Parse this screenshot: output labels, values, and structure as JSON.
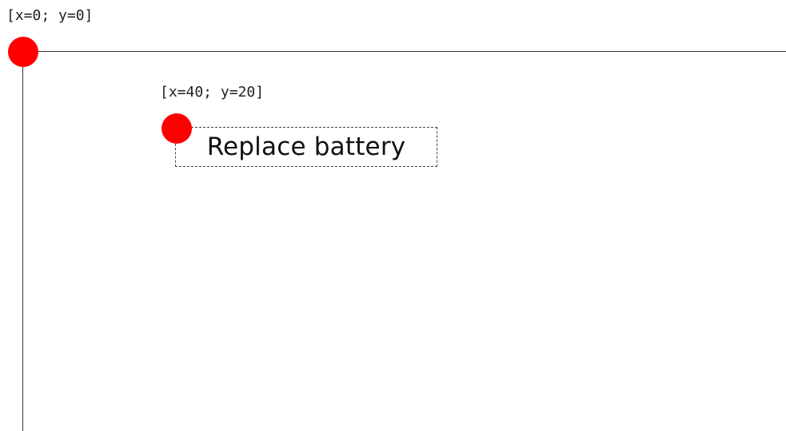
{
  "origin": {
    "label": "[x=0; y=0]",
    "marker_color": "#ff0000"
  },
  "element": {
    "coord_label": "[x=40; y=20]",
    "text": "Replace battery",
    "marker_color": "#ff0000"
  }
}
